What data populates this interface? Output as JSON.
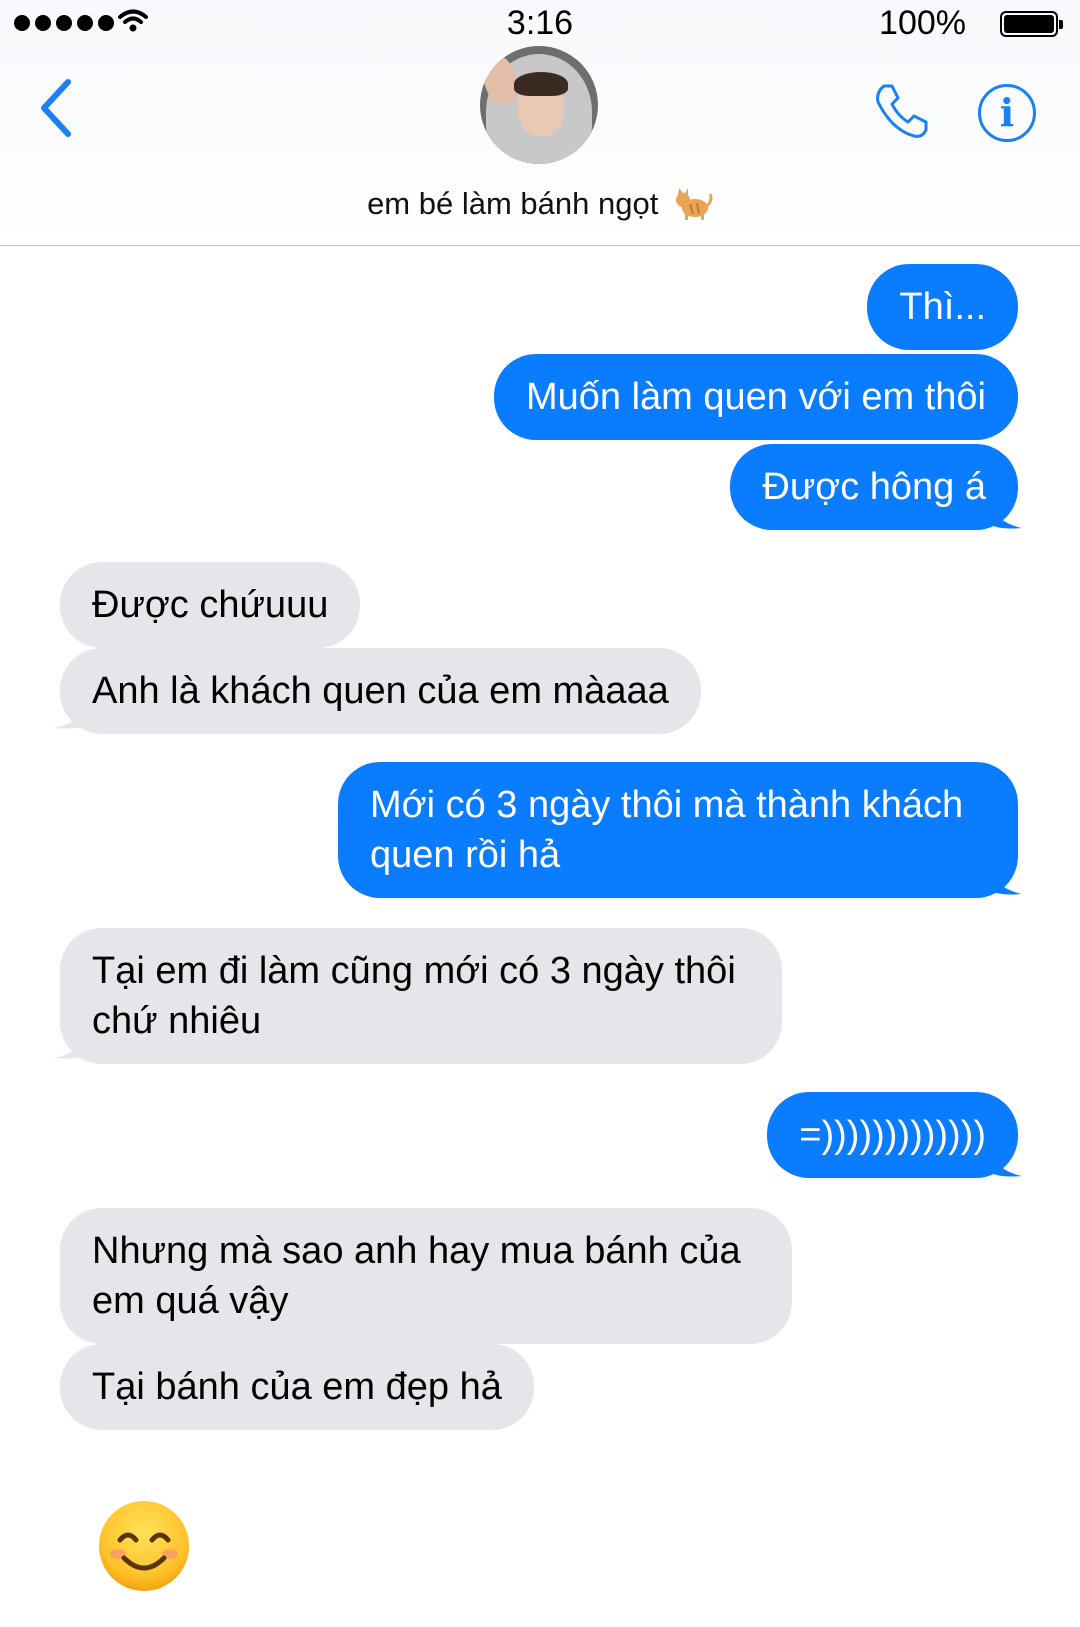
{
  "status": {
    "time": "3:16",
    "battery": "100%"
  },
  "header": {
    "contact_name": "em bé làm bánh ngọt",
    "contact_emoji": "cat-emoji",
    "accent_color": "#1a80f5"
  },
  "messages": [
    {
      "from": "me",
      "text": "Thì..."
    },
    {
      "from": "me",
      "text": "Muốn làm quen với em thôi"
    },
    {
      "from": "me",
      "text": "Được hông á"
    },
    {
      "from": "them",
      "text": "Được chứuuu"
    },
    {
      "from": "them",
      "text": "Anh là khách quen của em màaaa"
    },
    {
      "from": "me",
      "text": "Mới có 3 ngày thôi mà thành khách quen rồi hả"
    },
    {
      "from": "them",
      "text": "Tại em đi làm cũng mới có 3 ngày thôi chứ nhiêu"
    },
    {
      "from": "me",
      "text": "=)))))))))))))"
    },
    {
      "from": "them",
      "text": "Nhưng mà sao anh hay mua bánh của em quá vậy"
    },
    {
      "from": "them",
      "text": "Tại bánh của em đẹp hả"
    },
    {
      "from": "them",
      "emoji": "smiling-face-emoji"
    }
  ],
  "colors": {
    "outgoing_bubble": "#0a7cff",
    "incoming_bubble": "#e5e5ea"
  }
}
